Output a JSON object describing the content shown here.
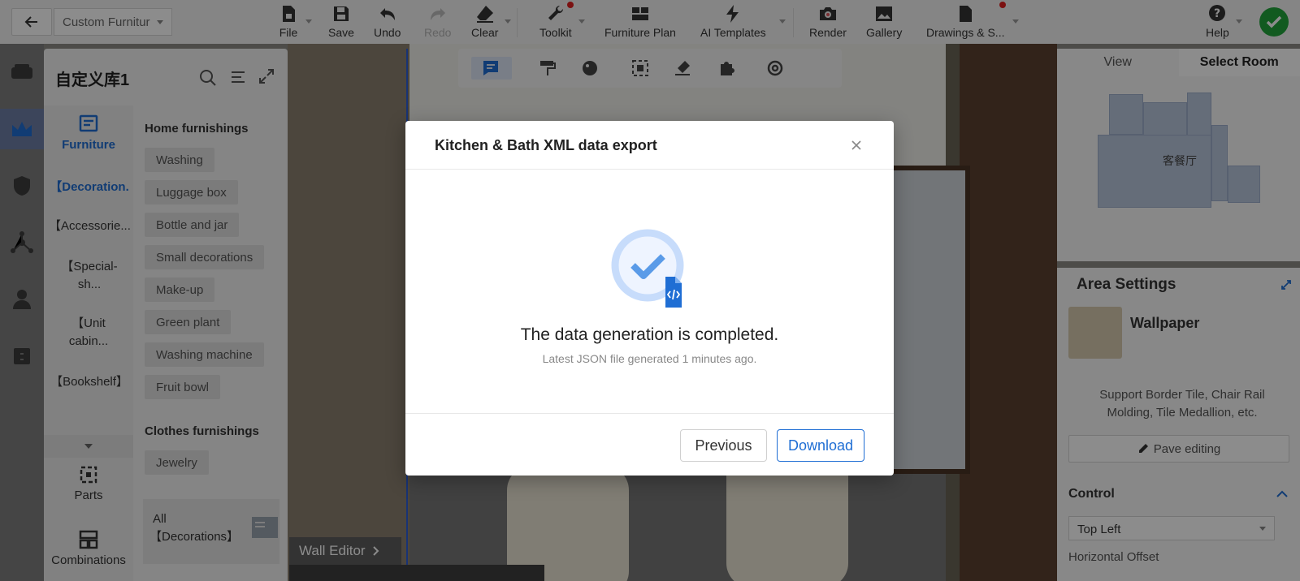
{
  "topbar": {
    "project_name": "Custom Furnitur",
    "tools": {
      "file": "File",
      "save": "Save",
      "undo": "Undo",
      "redo": "Redo",
      "clear": "Clear",
      "toolkit": "Toolkit",
      "furniture_plan": "Furniture Plan",
      "ai_templates": "AI Templates",
      "render": "Render",
      "gallery": "Gallery",
      "drawings": "Drawings & S...",
      "help": "Help"
    }
  },
  "library": {
    "title": "自定义库1",
    "main_category": "Furniture",
    "categories": [
      "【Decoration.",
      "【Accessorie...",
      "【Special-sh...",
      "【Unit cabin...",
      "【Bookshelf】"
    ],
    "bottom_tabs": {
      "parts": "Parts",
      "combinations": "Combinations"
    },
    "sections": [
      {
        "heading": "Home furnishings",
        "items": [
          "Washing",
          "Luggage box",
          "Bottle and jar",
          "Small decorations",
          "Make-up",
          "Green plant",
          "Washing machine",
          "Fruit bowl"
        ]
      },
      {
        "heading": "Clothes furnishings",
        "items": [
          "Jewelry"
        ]
      }
    ],
    "all_card": {
      "line1": "All",
      "line2": "【Decorations】"
    }
  },
  "scene": {
    "wall_editor_label": "Wall Editor"
  },
  "view_panel": {
    "tabs": [
      "View",
      "Select Room"
    ],
    "room_label": "客餐厅"
  },
  "area_settings": {
    "title": "Area Settings",
    "material_name": "Wallpaper",
    "description": "Support Border Tile, Chair Rail Molding, Tile Medallion, etc.",
    "pave_button": "Pave editing",
    "control_heading": "Control",
    "control_value": "Top Left",
    "horizontal_offset_label": "Horizontal Offset"
  },
  "modal": {
    "title": "Kitchen & Bath XML data export",
    "message": "The data generation is completed.",
    "submessage": "Latest JSON file generated 1 minutes ago.",
    "previous_button": "Previous",
    "download_button": "Download"
  },
  "colors": {
    "accent": "#1f6ed4",
    "success": "#21a43b",
    "notification": "#e02020"
  }
}
